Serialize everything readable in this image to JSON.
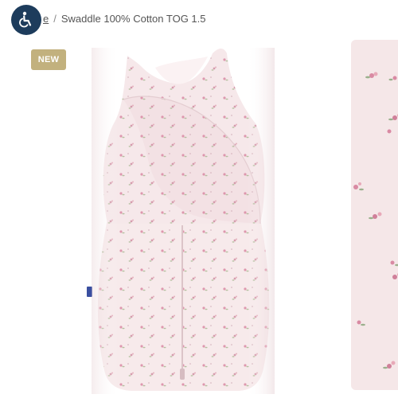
{
  "accessibility": {
    "icon": "accessibility-icon"
  },
  "breadcrumb": {
    "home_label": "e",
    "separator": "/",
    "current": "Swaddle 100% Cotton TOG 1.5"
  },
  "badge": {
    "label": "NEW"
  },
  "colors": {
    "a11y_bg": "#1d3c5c",
    "badge_bg": "#c2b17e",
    "fabric_pink": "#f5e7e8",
    "rose": "#d98aa3",
    "leaf": "#9bb08d",
    "brand_tag": "#3a4fa0"
  },
  "images": {
    "main": "product-image-main",
    "thumb": "product-image-secondary"
  }
}
